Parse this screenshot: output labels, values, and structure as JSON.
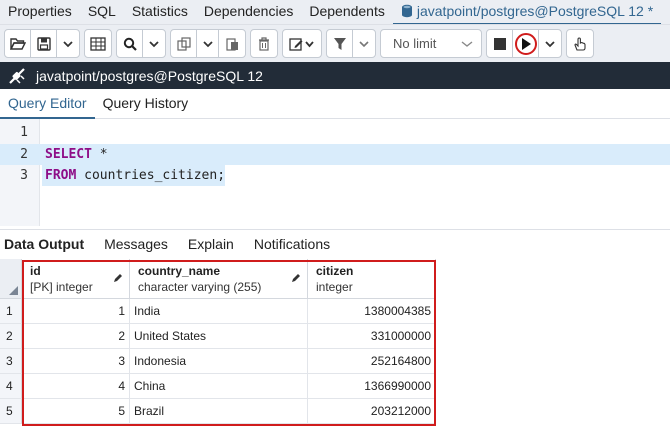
{
  "top_tabs": [
    "Properties",
    "SQL",
    "Statistics",
    "Dependencies",
    "Dependents"
  ],
  "active_tab": "javatpoint/postgres@PostgreSQL 12 *",
  "toolbar": {
    "limit_label": "No limit"
  },
  "connection": {
    "label": "javatpoint/postgres@PostgreSQL 12"
  },
  "editor_tabs": {
    "query_editor": "Query Editor",
    "query_history": "Query History"
  },
  "editor": {
    "lines": [
      {
        "num": "1",
        "kw": "",
        "text": ""
      },
      {
        "num": "2",
        "kw": "SELECT",
        "text": " *"
      },
      {
        "num": "3",
        "kw": "FROM",
        "text": " countries_citizen;"
      }
    ]
  },
  "output_tabs": {
    "data_output": "Data Output",
    "messages": "Messages",
    "explain": "Explain",
    "notifications": "Notifications"
  },
  "grid": {
    "columns": [
      {
        "name": "id",
        "type": "[PK] integer"
      },
      {
        "name": "country_name",
        "type": "character varying (255)"
      },
      {
        "name": "citizen",
        "type": "integer"
      }
    ],
    "rows": [
      {
        "row": "1",
        "id": "1",
        "country_name": "India",
        "citizen": "1380004385"
      },
      {
        "row": "2",
        "id": "2",
        "country_name": "United States",
        "citizen": "331000000"
      },
      {
        "row": "3",
        "id": "3",
        "country_name": "Indonesia",
        "citizen": "252164800"
      },
      {
        "row": "4",
        "id": "4",
        "country_name": "China",
        "citizen": "1366990000"
      },
      {
        "row": "5",
        "id": "5",
        "country_name": "Brazil",
        "citizen": "203212000"
      }
    ]
  },
  "colors": {
    "accent": "#326690",
    "keyword": "#8e0d87",
    "highlight_box": "#d01c1c",
    "conn_bar": "#222c38"
  }
}
